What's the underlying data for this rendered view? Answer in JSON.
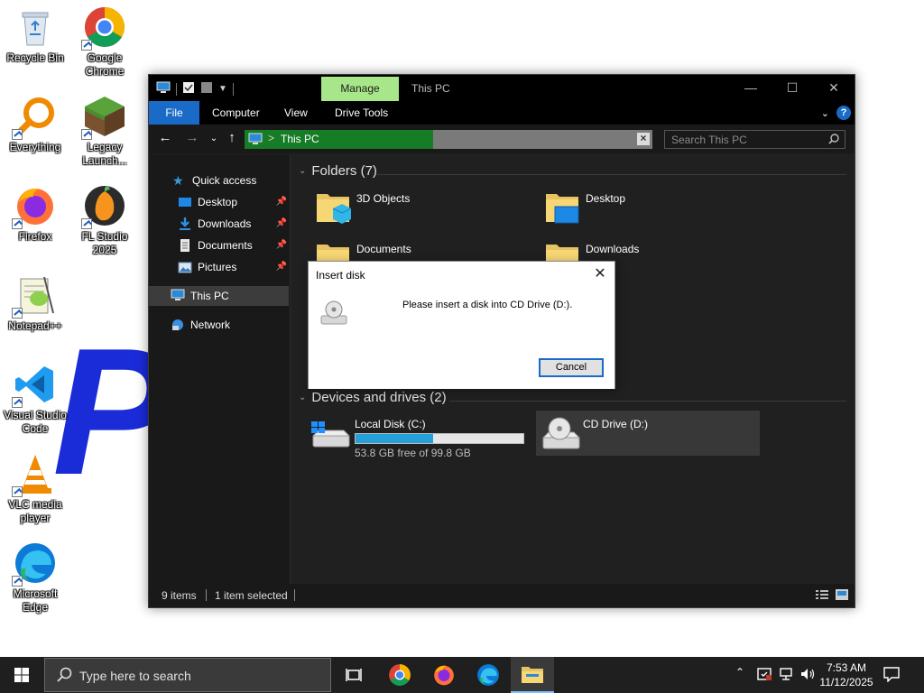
{
  "desktop": {
    "icons": [
      {
        "label": "Recycle Bin",
        "icon": "recycle-bin-icon"
      },
      {
        "label": "Google Chrome",
        "icon": "chrome-icon"
      },
      {
        "label": "Everything",
        "icon": "everything-search-icon"
      },
      {
        "label": "Legacy Launch...",
        "icon": "minecraft-legacy-launcher-icon"
      },
      {
        "label": "Firefox",
        "icon": "firefox-icon"
      },
      {
        "label": "FL Studio 2025",
        "icon": "fl-studio-icon"
      },
      {
        "label": "Notepad++",
        "icon": "notepad-plus-plus-icon"
      },
      {
        "label": "Visual Studio Code",
        "icon": "vscode-icon"
      },
      {
        "label": "VLC media player",
        "icon": "vlc-icon"
      },
      {
        "label": "Microsoft Edge",
        "icon": "edge-icon"
      }
    ],
    "wallpaper_glyph": "P"
  },
  "explorer": {
    "contextual_tab": "Manage",
    "title": "This PC",
    "ribbon_tabs": [
      "File",
      "Computer",
      "View",
      "Drive Tools"
    ],
    "address": {
      "path": "This PC",
      "separator": ">"
    },
    "search_placeholder": "Search This PC",
    "nav": {
      "quick_access": "Quick access",
      "quick_items": [
        "Desktop",
        "Downloads",
        "Documents",
        "Pictures"
      ],
      "this_pc": "This PC",
      "network": "Network"
    },
    "folders_header": "Folders (7)",
    "folders": [
      "3D Objects",
      "Desktop",
      "Documents",
      "Downloads"
    ],
    "devices_header": "Devices and drives (2)",
    "drives": [
      {
        "name": "Local Disk (C:)",
        "free_text": "53.8 GB free of 99.8 GB",
        "used_fraction": 0.46
      },
      {
        "name": "CD Drive (D:)"
      }
    ],
    "status": {
      "items": "9 items",
      "selected": "1 item selected"
    },
    "colors": {
      "manage_tab": "#a8e68a",
      "file_tab": "#1a6ac8",
      "address_highlight": "#177c26",
      "drive_bar": "#26a0da"
    }
  },
  "dialog": {
    "title": "Insert disk",
    "message": "Please insert a disk into CD Drive (D:).",
    "cancel": "Cancel"
  },
  "taskbar": {
    "search_placeholder": "Type here to search",
    "apps": [
      "task-view",
      "chrome",
      "firefox",
      "edge",
      "file-explorer"
    ],
    "time": "7:53 AM",
    "date": "11/12/2025"
  }
}
